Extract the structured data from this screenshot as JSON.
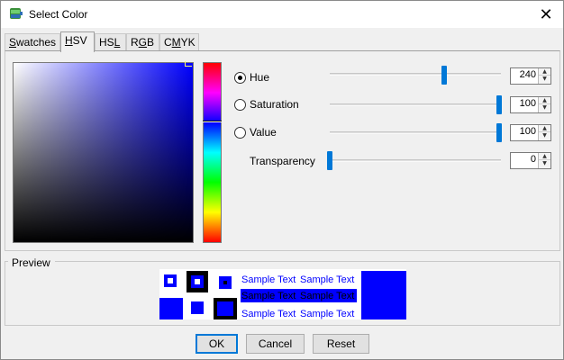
{
  "window": {
    "title": "Select Color",
    "app_icon": "java-cup-icon",
    "close_icon": "close-icon",
    "close_glyph": "✕"
  },
  "tabs": [
    {
      "pre": "",
      "mnemonic": "S",
      "post": "watches",
      "active": false
    },
    {
      "pre": "",
      "mnemonic": "H",
      "post": "SV",
      "active": true
    },
    {
      "pre": "HS",
      "mnemonic": "L",
      "post": "",
      "active": false
    },
    {
      "pre": "R",
      "mnemonic": "G",
      "post": "B",
      "active": false
    },
    {
      "pre": "C",
      "mnemonic": "M",
      "post": "YK",
      "active": false
    }
  ],
  "hsv": {
    "rows": [
      {
        "label": "Hue",
        "value": "240",
        "selected": true,
        "level_fraction": 0.667
      },
      {
        "label": "Saturation",
        "value": "100",
        "selected": false,
        "level_fraction": 1.0
      },
      {
        "label": "Value",
        "value": "100",
        "selected": false,
        "level_fraction": 1.0
      }
    ],
    "transparency": {
      "label": "Transparency",
      "value": "0",
      "level_fraction": 0.0
    }
  },
  "preview": {
    "label": "Preview",
    "sample_text": "Sample Text",
    "selected_color": "#0000ff"
  },
  "colors": {
    "accent": "#0078d7",
    "selected": "#0000ff",
    "sample_text_highlight": "#000000"
  },
  "buttons": {
    "ok": "OK",
    "cancel": "Cancel",
    "reset": "Reset"
  }
}
